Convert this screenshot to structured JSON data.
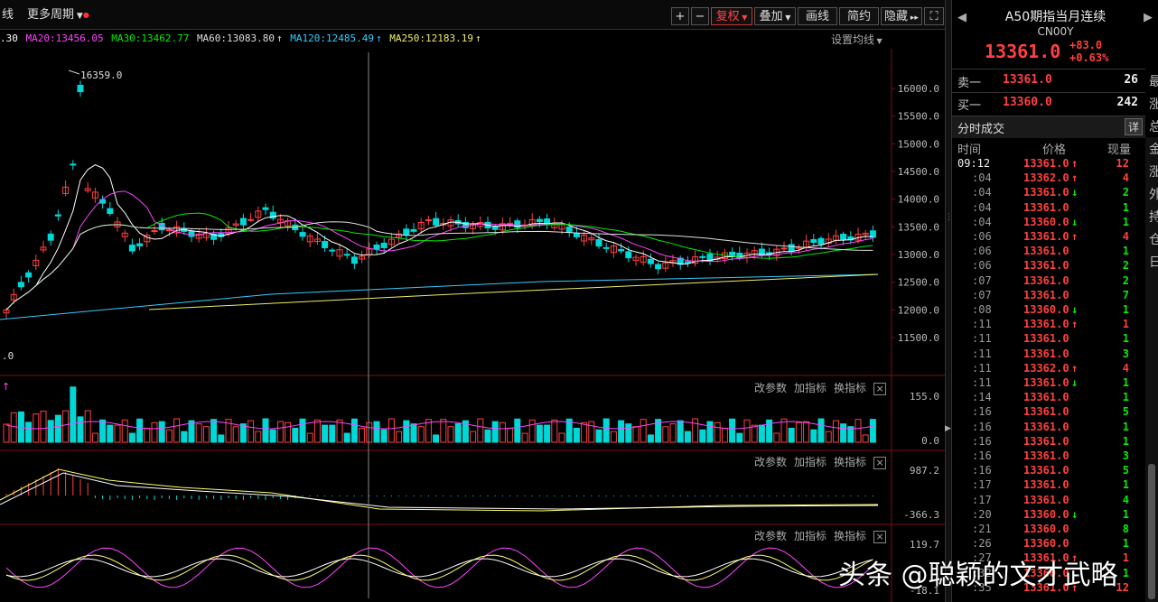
{
  "toolbar": {
    "left_label": "线",
    "period_label": "更多周期",
    "plus": "+",
    "minus": "−",
    "restore_label": "复权",
    "overlay_label": "叠加",
    "draw_label": "画线",
    "simple_label": "简约",
    "hide_label": "隐藏",
    "expand_icon": "fullscreen-icon"
  },
  "ma_bar": {
    "ma10": ".30",
    "ma20": "MA20:13456.05",
    "ma30": "MA30:13462.77",
    "ma60": "MA60:13083.80",
    "ma120": "MA120:12485.49",
    "ma250": "MA250:12183.19",
    "settings_label": "设置均线"
  },
  "main_chart": {
    "yticks": [
      "16000.0",
      "15500.0",
      "15000.0",
      "14500.0",
      "14000.0",
      "13500.0",
      "13000.0",
      "12500.0",
      "12000.0",
      "11500.0"
    ],
    "high_label": "16359.0",
    "low_label": ".0"
  },
  "sub_panels": [
    {
      "buttons": [
        "改参数",
        "加指标",
        "换指标"
      ],
      "top_value": "155.0",
      "bottom_value": "0.0"
    },
    {
      "buttons": [
        "改参数",
        "加指标",
        "换指标"
      ],
      "top_value": "987.2",
      "bottom_value": "-366.3"
    },
    {
      "buttons": [
        "改参数",
        "加指标",
        "换指标"
      ],
      "top_value": "119.7",
      "bottom_value": "-18.1"
    }
  ],
  "quote": {
    "title": "A50期指当月连续",
    "code": "CN00Y",
    "price": "13361.0",
    "change": "+83.0",
    "change_pct": "+0.63%",
    "sell1_label": "卖一",
    "sell1_price": "13361.0",
    "sell1_vol": "26",
    "buy1_label": "买一",
    "buy1_price": "13360.0",
    "buy1_vol": "242",
    "ticks_title": "分时成交",
    "detail_btn": "详",
    "col_time": "时间",
    "col_price": "价格",
    "col_vol": "现量",
    "right_edge_chars": [
      "最",
      "涨",
      "总",
      "金",
      "涨",
      "外",
      "持",
      "仓",
      "日"
    ]
  },
  "ticks": [
    {
      "t": "09:12",
      "p": "13361.0",
      "d": "up",
      "v": "12"
    },
    {
      "t": ":04",
      "p": "13362.0",
      "d": "up",
      "v": "4"
    },
    {
      "t": ":04",
      "p": "13361.0",
      "d": "down",
      "v": "2"
    },
    {
      "t": ":04",
      "p": "13361.0",
      "d": "",
      "v": "1"
    },
    {
      "t": ":04",
      "p": "13360.0",
      "d": "down",
      "v": "1"
    },
    {
      "t": ":06",
      "p": "13361.0",
      "d": "up",
      "v": "4"
    },
    {
      "t": ":06",
      "p": "13361.0",
      "d": "",
      "v": "1"
    },
    {
      "t": ":06",
      "p": "13361.0",
      "d": "",
      "v": "2"
    },
    {
      "t": ":07",
      "p": "13361.0",
      "d": "",
      "v": "2"
    },
    {
      "t": ":07",
      "p": "13361.0",
      "d": "",
      "v": "7"
    },
    {
      "t": ":08",
      "p": "13360.0",
      "d": "down",
      "v": "1"
    },
    {
      "t": ":11",
      "p": "13361.0",
      "d": "up",
      "v": "1"
    },
    {
      "t": ":11",
      "p": "13361.0",
      "d": "",
      "v": "1"
    },
    {
      "t": ":11",
      "p": "13361.0",
      "d": "",
      "v": "3"
    },
    {
      "t": ":11",
      "p": "13362.0",
      "d": "up",
      "v": "4"
    },
    {
      "t": ":11",
      "p": "13361.0",
      "d": "down",
      "v": "1"
    },
    {
      "t": ":14",
      "p": "13361.0",
      "d": "",
      "v": "1"
    },
    {
      "t": ":16",
      "p": "13361.0",
      "d": "",
      "v": "5"
    },
    {
      "t": ":16",
      "p": "13361.0",
      "d": "",
      "v": "1"
    },
    {
      "t": ":16",
      "p": "13361.0",
      "d": "",
      "v": "1"
    },
    {
      "t": ":16",
      "p": "13361.0",
      "d": "",
      "v": "3"
    },
    {
      "t": ":16",
      "p": "13361.0",
      "d": "",
      "v": "5"
    },
    {
      "t": ":17",
      "p": "13361.0",
      "d": "",
      "v": "1"
    },
    {
      "t": ":17",
      "p": "13361.0",
      "d": "",
      "v": "4"
    },
    {
      "t": ":20",
      "p": "13360.0",
      "d": "down",
      "v": "1"
    },
    {
      "t": ":21",
      "p": "13360.0",
      "d": "",
      "v": "8"
    },
    {
      "t": ":26",
      "p": "13360.0",
      "d": "",
      "v": "1"
    },
    {
      "t": ":27",
      "p": "13361.0",
      "d": "up",
      "v": "1"
    },
    {
      "t": ":32",
      "p": "13360.0",
      "d": "",
      "v": "1"
    },
    {
      "t": ":35",
      "p": "13361.0",
      "d": "up",
      "v": "12"
    }
  ],
  "watermark": "头条 @聪颖的文才武略",
  "colors": {
    "up": "#ff4040",
    "down": "#00d8d8",
    "ma10": "#ffffff",
    "ma20": "#ff44ff",
    "ma30": "#00ee00",
    "ma60": "#dddddd",
    "ma120": "#33ccff",
    "ma250": "#eeee66"
  }
}
